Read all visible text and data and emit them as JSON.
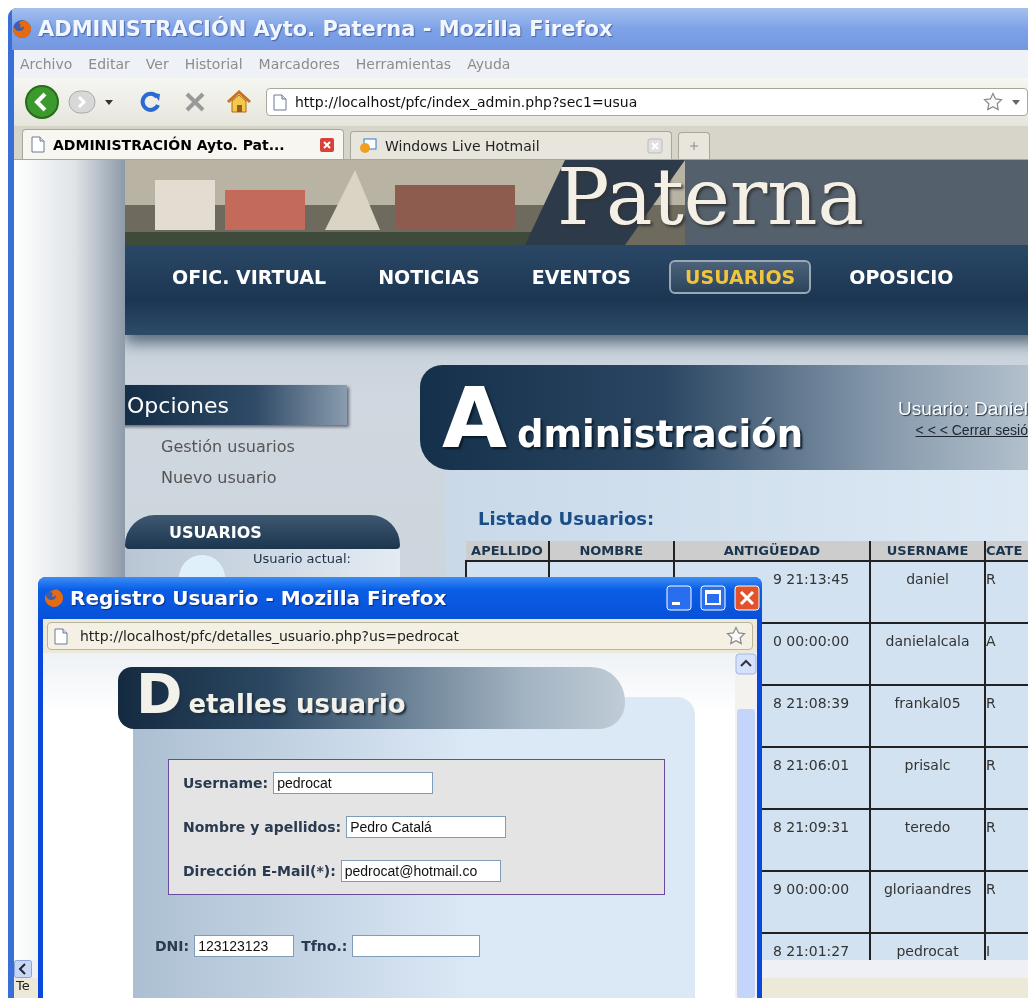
{
  "window": {
    "title": "ADMINISTRACIÓN Ayto. Paterna - Mozilla Firefox"
  },
  "menu": [
    "Archivo",
    "Editar",
    "Ver",
    "Historial",
    "Marcadores",
    "Herramientas",
    "Ayuda"
  ],
  "address_bar": {
    "url": "http://localhost/pfc/index_admin.php?sec1=usua"
  },
  "tabs": [
    {
      "label": "ADMINISTRACIÓN Ayto. Pat...",
      "selected": true
    },
    {
      "label": "Windows Live Hotmail",
      "selected": false
    }
  ],
  "page": {
    "logo": "Paterna",
    "nav": [
      {
        "label": "OFIC. VIRTUAL",
        "selected": false
      },
      {
        "label": "NOTICIAS",
        "selected": false
      },
      {
        "label": "EVENTOS",
        "selected": false
      },
      {
        "label": "USUARIOS",
        "selected": true
      },
      {
        "label": "OPOSICIO",
        "selected": false
      }
    ],
    "sidebar": {
      "title": "Opciones",
      "links": [
        "Gestión usuarios",
        "Nuevo usuario"
      ],
      "box_title": "USUARIOS",
      "box_text": "Usuario actual:"
    },
    "header": {
      "title": "Administración",
      "user": "Usuario: Daniel",
      "logout": "< < < Cerrar sesió"
    },
    "listing": {
      "title": "Listado Usuarios:",
      "columns": [
        "APELLIDO",
        "NOMBRE",
        "ANTIGÜEDAD",
        "USERNAME",
        "CATE"
      ],
      "rows": [
        {
          "antiguedad": "9 21:13:45",
          "username": "daniel",
          "column_5": "R"
        },
        {
          "antiguedad": "0 00:00:00",
          "username": "danielalcala",
          "column_5": "A"
        },
        {
          "antiguedad": "8 21:08:39",
          "username": "frankal05",
          "column_5": "R"
        },
        {
          "antiguedad": "8 21:06:01",
          "username": "prisalc",
          "column_5": "R"
        },
        {
          "antiguedad": "8 21:09:31",
          "username": "teredo",
          "column_5": "R"
        },
        {
          "antiguedad": "9 00:00:00",
          "username": "gloriaandres",
          "column_5": "R"
        },
        {
          "antiguedad": "8 21:01:27",
          "username": "pedrocat",
          "column_5": "I"
        }
      ]
    }
  },
  "status_bar": "Te",
  "popup": {
    "title": "Registro Usuario - Mozilla Firefox",
    "url": "http://localhost/pfc/detalles_usuario.php?us=pedrocat",
    "heading": "Detalles usuario",
    "fields": [
      {
        "label": "Username:",
        "value": "pedrocat"
      },
      {
        "label": "Nombre y apellidos:",
        "value": "Pedro Catalá"
      },
      {
        "label": "Dirección E-Mail(*):",
        "value": "pedrocat@hotmail.co"
      }
    ],
    "dni": {
      "label": "DNI:",
      "value": "123123123"
    },
    "tfno": {
      "label": "Tfno.:"
    }
  }
}
